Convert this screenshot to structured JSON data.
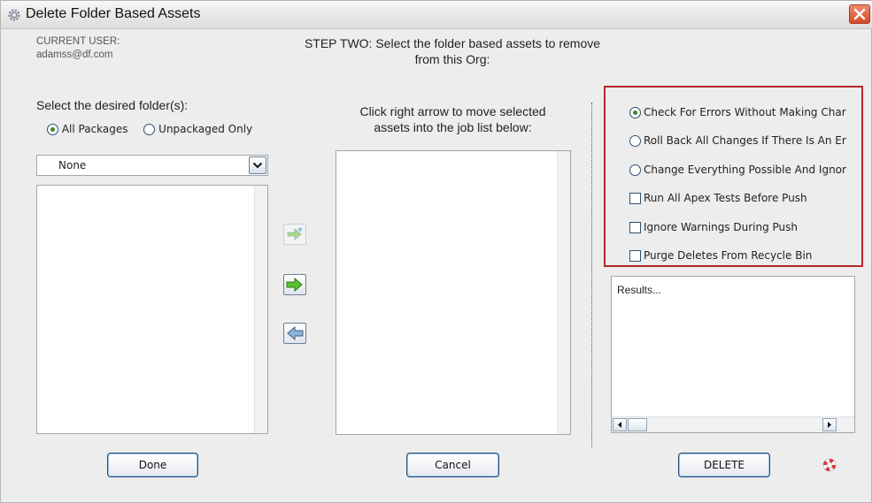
{
  "window": {
    "title": "Delete Folder Based Assets"
  },
  "user": {
    "label": "CURRENT USER:",
    "email": "adamss@df.com"
  },
  "step": {
    "line1": "STEP TWO: Select the folder based assets to remove",
    "line2": "from this Org:"
  },
  "left": {
    "folders_label": "Select the desired folder(s):",
    "filter_options": [
      {
        "label": "All Packages",
        "selected": true
      },
      {
        "label": "Unpackaged Only",
        "selected": false
      }
    ],
    "dropdown_value": "None"
  },
  "middle": {
    "instruction_line1": "Click right arrow to move selected",
    "instruction_line2": "assets into the job list below:"
  },
  "options": {
    "radios": [
      {
        "label": "Check For Errors Without Making Char",
        "selected": true
      },
      {
        "label": "Roll Back All Changes If There Is An Er",
        "selected": false
      },
      {
        "label": "Change Everything Possible And Ignor",
        "selected": false
      }
    ],
    "checkboxes": [
      {
        "label": "Run All Apex Tests Before Push",
        "checked": false
      },
      {
        "label": "Ignore Warnings During Push",
        "checked": false
      },
      {
        "label": "Purge Deletes From Recycle Bin",
        "checked": false
      }
    ],
    "highlight_color": "#b5262b"
  },
  "results": {
    "text": "Results..."
  },
  "buttons": {
    "done": "Done",
    "cancel": "Cancel",
    "delete": "DELETE"
  },
  "icons": {
    "title": "gear-icon",
    "close": "close-icon",
    "add_arrow": "arrow-right-plus-icon",
    "move_right": "arrow-right-icon",
    "move_left": "arrow-left-icon",
    "help": "lifebuoy-icon"
  }
}
